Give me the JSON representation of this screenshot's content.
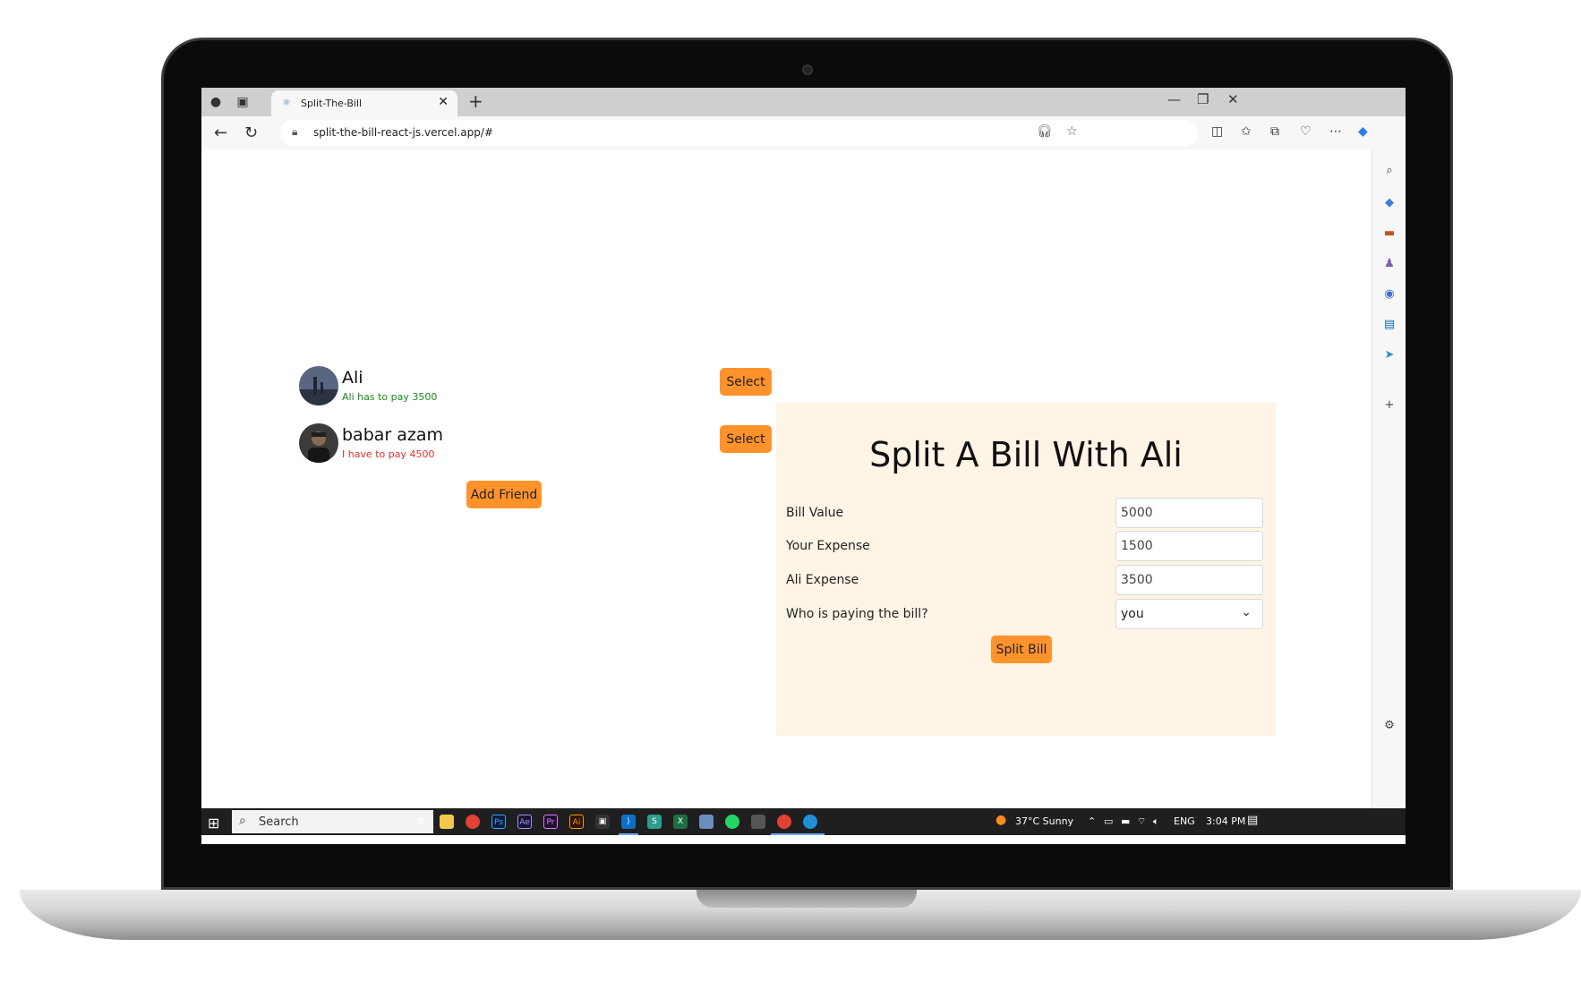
{
  "browser": {
    "tab_title": "Split-The-Bill",
    "url": "split-the-bill-react-js.vercel.app/#"
  },
  "friends": [
    {
      "name": "Ali",
      "balance": "Ali has to pay 3500",
      "balance_color": "#1a8a1a",
      "select_label": "Select"
    },
    {
      "name": "babar azam",
      "balance": "I have to pay 4500",
      "balance_color": "#e03131",
      "select_label": "Select"
    }
  ],
  "add_friend_label": "Add Friend",
  "split_form": {
    "title": "Split A Bill With Ali",
    "bill_label": "Bill Value",
    "bill_value": "5000",
    "your_expense_label": "Your Expense",
    "your_expense_value": "1500",
    "friend_expense_label": "Ali Expense",
    "friend_expense_value": "3500",
    "payer_label": "Who is paying the bill?",
    "payer_value": "you",
    "submit_label": "Split Bill"
  },
  "taskbar": {
    "search_placeholder": "Search",
    "weather": "37°C  Sunny",
    "lang": "ENG",
    "time": "3:04 PM"
  },
  "colors": {
    "accent": "#ff922b",
    "panel_bg": "#fff4e6"
  }
}
